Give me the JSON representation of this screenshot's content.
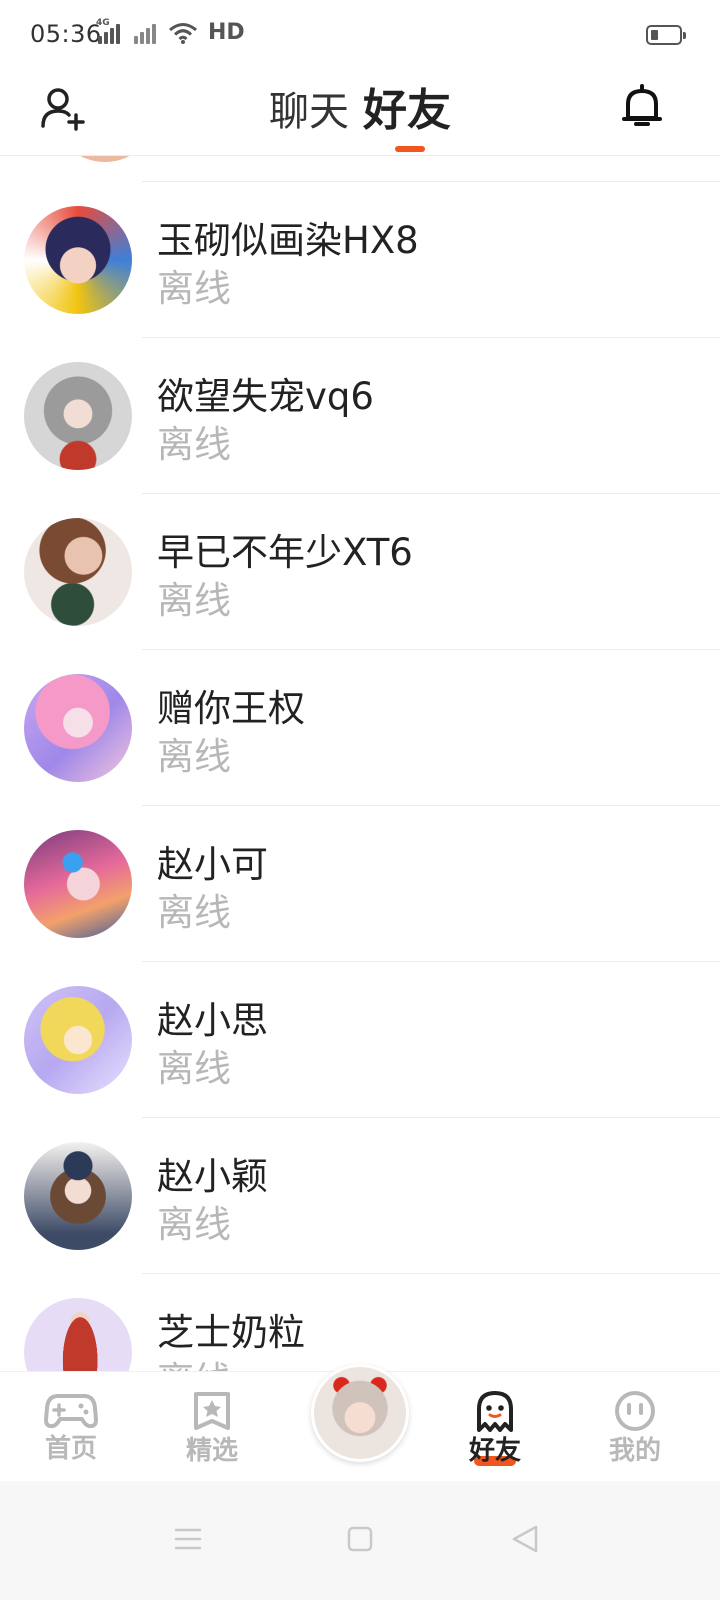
{
  "status_bar": {
    "time": "05:36",
    "network_label": "4G",
    "hd_label": "HD",
    "icons": [
      "signal-4g-icon",
      "signal-no-service-icon",
      "wifi-icon",
      "hd-icon",
      "battery-icon"
    ]
  },
  "header": {
    "tab_chat": "聊天",
    "tab_friends": "好友",
    "active_tab": "好友",
    "accent_color": "#f0561d",
    "left_icon": "add-friend-icon",
    "right_icon": "bell-icon"
  },
  "friends": [
    {
      "name": "玉砌似画染HX8",
      "status": "离线"
    },
    {
      "name": "欲望失宠vq6",
      "status": "离线"
    },
    {
      "name": "早已不年少XT6",
      "status": "离线"
    },
    {
      "name": "赠你王权",
      "status": "离线"
    },
    {
      "name": "赵小可",
      "status": "离线"
    },
    {
      "name": "赵小思",
      "status": "离线"
    },
    {
      "name": "赵小颖",
      "status": "离线"
    },
    {
      "name": "芝士奶粒",
      "status": "离线"
    }
  ],
  "bottom_nav": {
    "items": [
      {
        "label": "首页",
        "icon": "gamepad-icon"
      },
      {
        "label": "精选",
        "icon": "star-badge-icon"
      },
      {
        "label": "好友",
        "icon": "ghost-icon",
        "active": true
      },
      {
        "label": "我的",
        "icon": "smiley-icon"
      }
    ],
    "center_icon": "profile-avatar"
  },
  "system_nav": {
    "icons": [
      "menu-icon",
      "home-square-icon",
      "back-triangle-icon"
    ]
  }
}
